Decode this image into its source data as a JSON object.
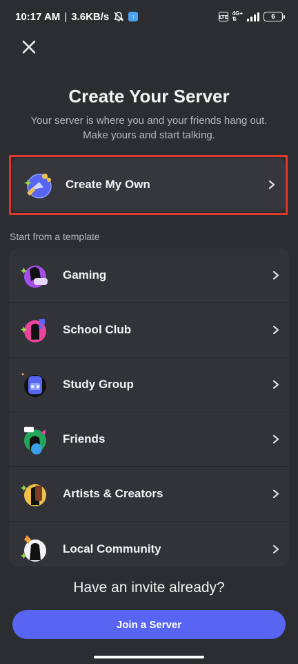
{
  "status_bar": {
    "time": "10:17 AM",
    "separator": "|",
    "speed": "3.6KB/s",
    "network": "4G+",
    "battery": "6",
    "icons": [
      "bell-off-icon",
      "cloud-sync-icon",
      "volte-icon",
      "signal-icon",
      "battery-icon"
    ]
  },
  "header": {
    "close_icon": "close-icon",
    "title": "Create Your Server",
    "subtitle_line1": "Your server is where you and your friends hang out.",
    "subtitle_line2": "Make yours and start talking."
  },
  "create_own": {
    "label": "Create My Own",
    "icon": "globe-star-icon",
    "chevron": "chevron-right-icon",
    "highlight_color": "#e03a2f"
  },
  "templates": {
    "section_label": "Start from a template",
    "items": [
      {
        "label": "Gaming",
        "icon": "gaming-icon"
      },
      {
        "label": "School Club",
        "icon": "school-club-icon"
      },
      {
        "label": "Study Group",
        "icon": "study-group-icon"
      },
      {
        "label": "Friends",
        "icon": "friends-icon"
      },
      {
        "label": "Artists & Creators",
        "icon": "artists-icon"
      },
      {
        "label": "Local Community",
        "icon": "local-community-icon"
      }
    ]
  },
  "footer": {
    "invite_text": "Have an invite already?",
    "join_button": "Join a Server",
    "accent": "#5865f2"
  }
}
